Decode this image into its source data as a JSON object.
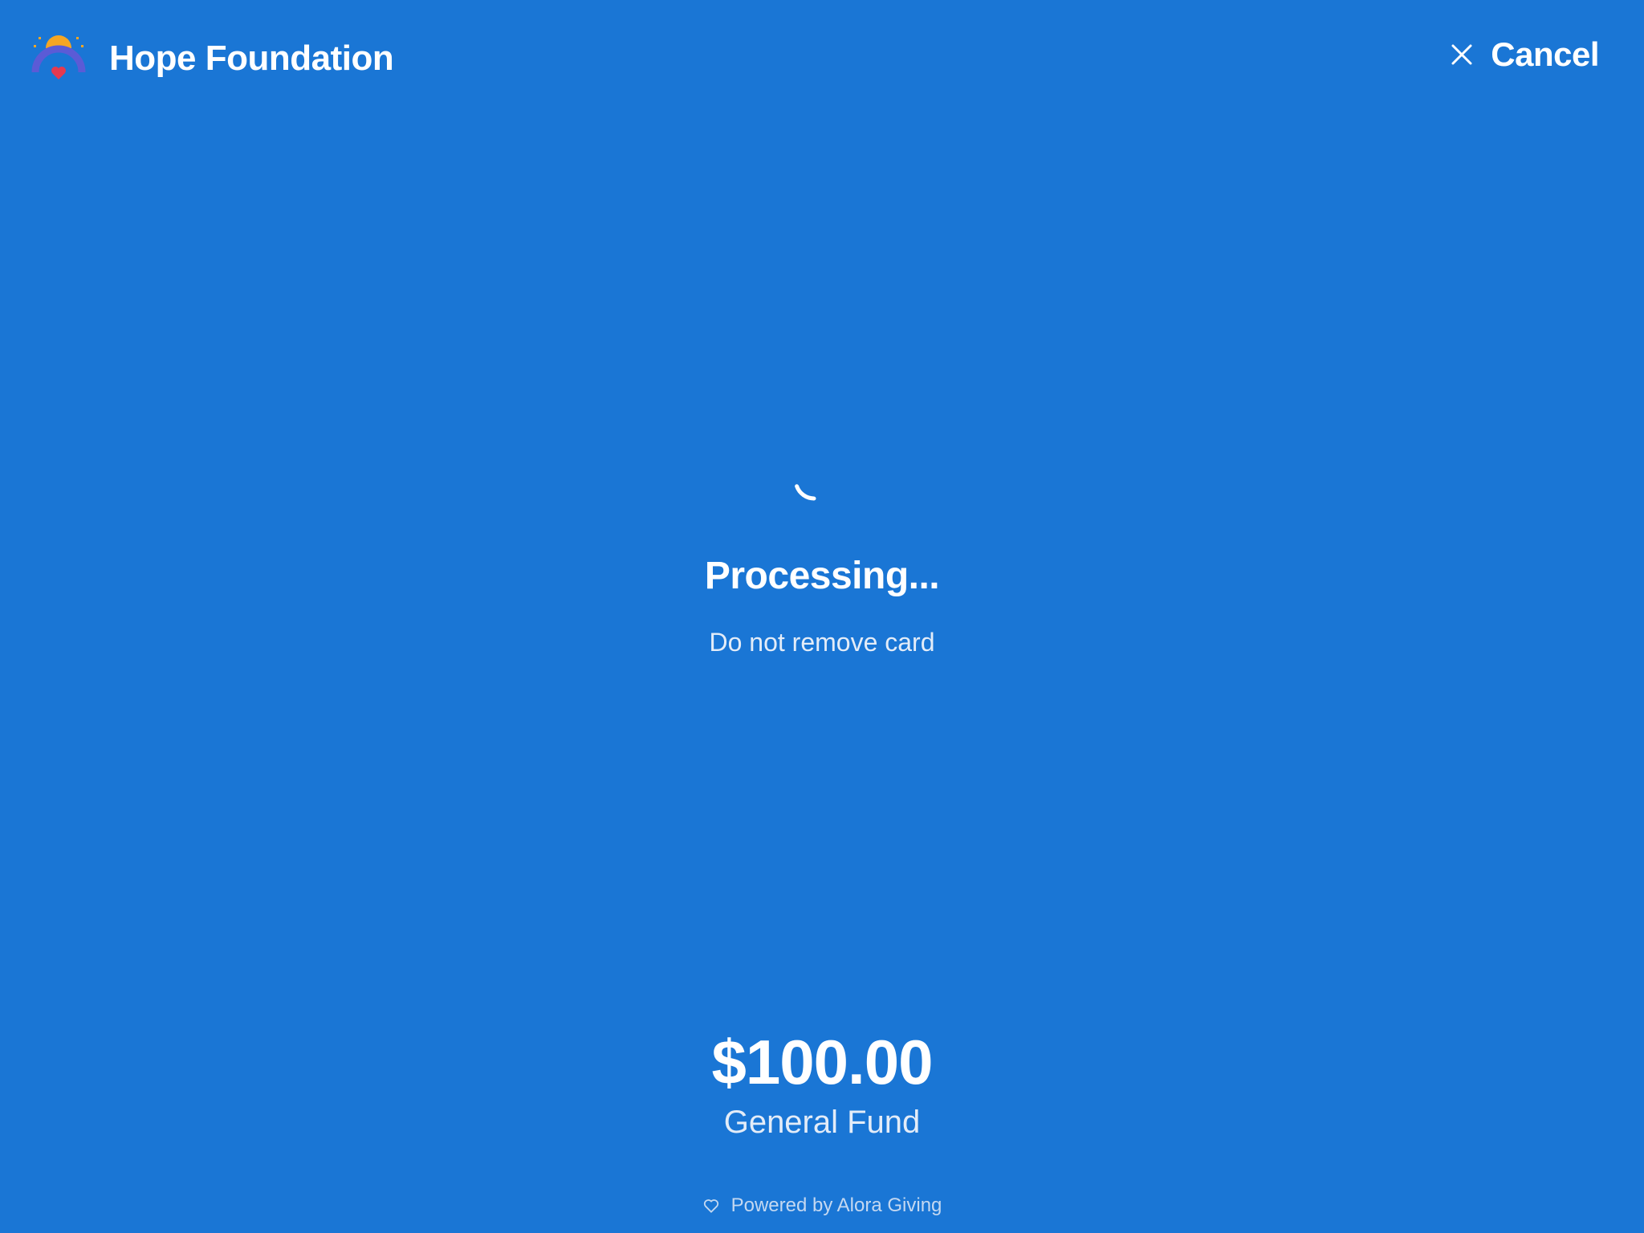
{
  "header": {
    "org_name": "Hope Foundation",
    "logo_icon": "rainbow-sun-heart-logo",
    "cancel_label": "Cancel",
    "cancel_icon": "close-icon"
  },
  "status": {
    "title": "Processing...",
    "subtitle": "Do not remove card",
    "spinner_icon": "loading-spinner-icon"
  },
  "donation": {
    "amount": "$100.00",
    "fund": "General Fund"
  },
  "footer": {
    "powered_by": "Powered by Alora Giving",
    "icon": "heart-outline-icon"
  },
  "colors": {
    "background": "#1a76d5",
    "text": "#ffffff",
    "logo_arc": "#5b5bd6",
    "logo_sun": "#f5a623",
    "logo_heart": "#e53950"
  }
}
